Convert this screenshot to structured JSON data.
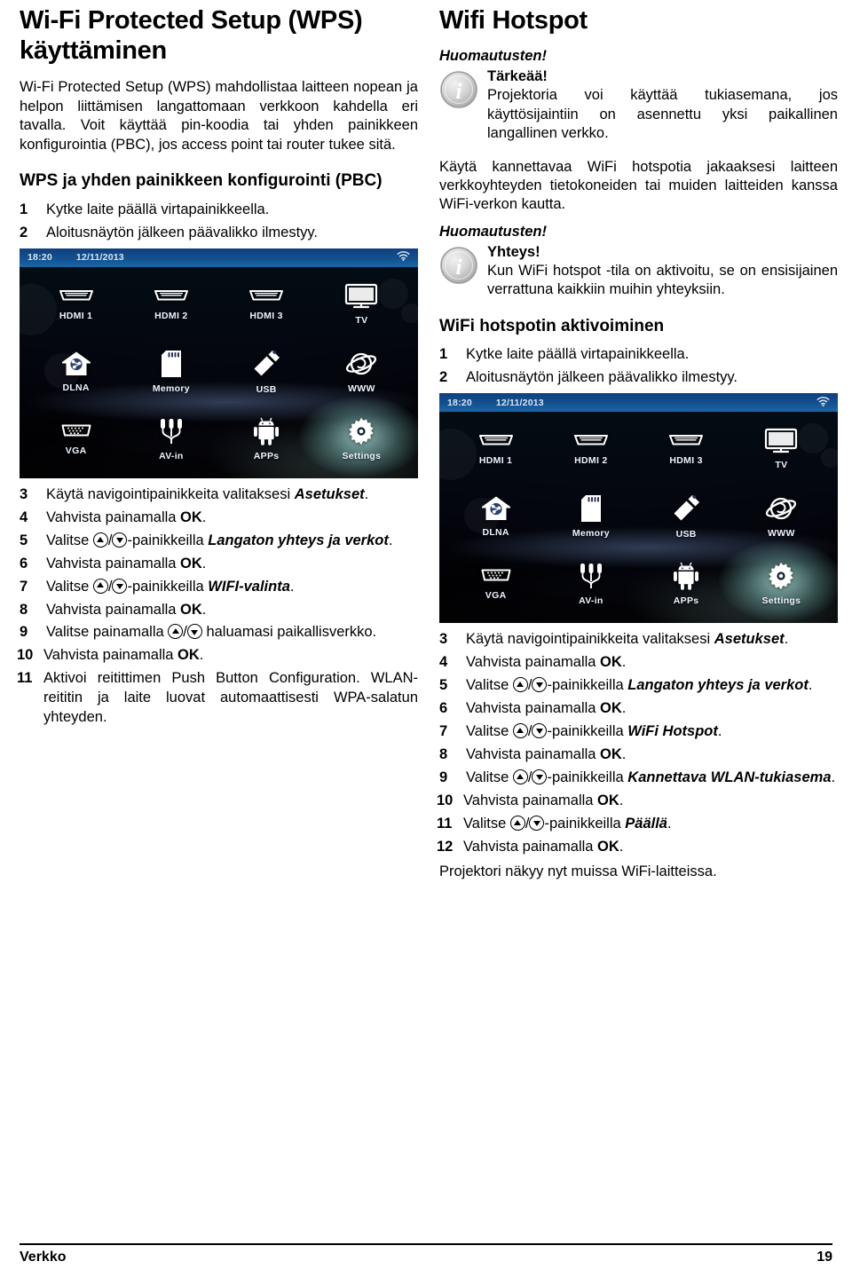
{
  "left": {
    "title": "Wi-Fi Protected Setup (WPS) käyttäminen",
    "intro": "Wi-Fi Protected Setup (WPS) mahdollistaa laitteen nopean ja helpon liittämisen langattomaan verkkoon kahdella eri tavalla. Voit käyttää pin-koodia tai yhden painikkeen konfigurointia (PBC), jos access point tai router tukee sitä.",
    "subhead": "WPS ja yhden painikkeen konfigurointi (PBC)",
    "step1_num": "1",
    "step1": "Kytke laite päällä virtapainikkeella.",
    "step2_num": "2",
    "step2": "Aloitusnäytön jälkeen päävalikko ilmestyy.",
    "steps": [
      {
        "num": "3",
        "pre": "Käytä navigointipainikkeita valitaksesi ",
        "em": "Asetukset",
        "post": "."
      },
      {
        "num": "4",
        "pre": "Vahvista painamalla ",
        "bold": "OK",
        "post": "."
      },
      {
        "num": "5",
        "pre": "Valitse ",
        "keys": true,
        "mid": "-painikkeilla ",
        "em": "Langaton yhteys ja verkot",
        "post": "."
      },
      {
        "num": "6",
        "pre": "Vahvista painamalla ",
        "bold": "OK",
        "post": "."
      },
      {
        "num": "7",
        "pre": "Valitse ",
        "keys": true,
        "mid": "-painikkeilla ",
        "em": "WIFI-valinta",
        "post": "."
      },
      {
        "num": "8",
        "pre": "Vahvista painamalla ",
        "bold": "OK",
        "post": "."
      },
      {
        "num": "9",
        "pre": "Valitse painamalla ",
        "keys": true,
        "mid": " haluamasi paikallisverkko.",
        "em": "",
        "post": ""
      },
      {
        "num": "10",
        "pre": "Vahvista painamalla ",
        "bold": "OK",
        "post": "."
      },
      {
        "num": "11",
        "pre": "Aktivoi reitittimen Push Button Configuration. WLAN-reititin ja laite luovat automaattisesti WPA-salatun yhteyden.",
        "post": ""
      }
    ]
  },
  "right": {
    "title": "Wifi Hotspot",
    "note1_label": "Huomautusten!",
    "note1_head": "Tärkeää!",
    "note1_text": "Projektoria voi käyttää tukiasemana, jos käyttösijaintiin on asennettu yksi paikallinen langallinen verkko.",
    "para": "Käytä kannettavaa WiFi hotspotia jakaaksesi laitteen verkkoyhteyden tietokoneiden tai muiden laitteiden kanssa WiFi-verkon kautta.",
    "note2_label": "Huomautusten!",
    "note2_head": "Yhteys!",
    "note2_text": "Kun WiFi hotspot -tila on aktivoitu, se on ensisijainen verrattuna kaikkiin muihin yhteyksiin.",
    "subhead": "WiFi hotspotin aktivoiminen",
    "step1_num": "1",
    "step1": "Kytke laite päällä virtapainikkeella.",
    "step2_num": "2",
    "step2": "Aloitusnäytön jälkeen päävalikko ilmestyy.",
    "steps": [
      {
        "num": "3",
        "pre": "Käytä navigointipainikkeita valitaksesi ",
        "em": "Asetukset",
        "post": "."
      },
      {
        "num": "4",
        "pre": "Vahvista painamalla ",
        "bold": "OK",
        "post": "."
      },
      {
        "num": "5",
        "pre": "Valitse ",
        "keys": true,
        "mid": "-painikkeilla ",
        "em": "Langaton yhteys ja verkot",
        "post": "."
      },
      {
        "num": "6",
        "pre": "Vahvista painamalla ",
        "bold": "OK",
        "post": "."
      },
      {
        "num": "7",
        "pre": "Valitse ",
        "keys": true,
        "mid": "-painikkeilla ",
        "em": "WiFi Hotspot",
        "post": "."
      },
      {
        "num": "8",
        "pre": "Vahvista painamalla ",
        "bold": "OK",
        "post": "."
      },
      {
        "num": "9",
        "pre": "Valitse ",
        "keys": true,
        "mid": "-painikkeilla ",
        "em": "Kannettava WLAN-tukiasema",
        "post": "."
      },
      {
        "num": "10",
        "pre": "Vahvista painamalla ",
        "bold": "OK",
        "post": "."
      },
      {
        "num": "11",
        "pre": "Valitse ",
        "keys": true,
        "mid": "-painikkeilla ",
        "em": "Päällä",
        "post": "."
      },
      {
        "num": "12",
        "pre": "Vahvista painamalla ",
        "bold": "OK",
        "post": "."
      }
    ],
    "closing": "Projektori näkyy nyt muissa WiFi-laitteissa."
  },
  "screenshot": {
    "time": "18:20",
    "date": "12/11/2013",
    "wifi_icon": "wifi-signal-icon",
    "tiles": [
      {
        "label": "HDMI 1",
        "icon": "hdmi-port-icon"
      },
      {
        "label": "HDMI 2",
        "icon": "hdmi-port-icon"
      },
      {
        "label": "HDMI 3",
        "icon": "hdmi-port-icon"
      },
      {
        "label": "TV",
        "icon": "television-icon"
      },
      {
        "label": "DLNA",
        "icon": "dlna-home-share-icon"
      },
      {
        "label": "Memory",
        "icon": "sd-memory-card-icon"
      },
      {
        "label": "USB",
        "icon": "usb-stick-icon"
      },
      {
        "label": "WWW",
        "icon": "globe-browser-icon"
      },
      {
        "label": "VGA",
        "icon": "vga-port-icon"
      },
      {
        "label": "AV-in",
        "icon": "av-cable-icon"
      },
      {
        "label": "APPs",
        "icon": "android-robot-icon"
      },
      {
        "label": "Settings",
        "icon": "gear-settings-icon",
        "selected": true
      }
    ]
  },
  "footer": {
    "section": "Verkko",
    "page": "19"
  },
  "colors": {
    "status_bar": "#14508f",
    "glow": "#bef9f3",
    "text": "#000000"
  }
}
